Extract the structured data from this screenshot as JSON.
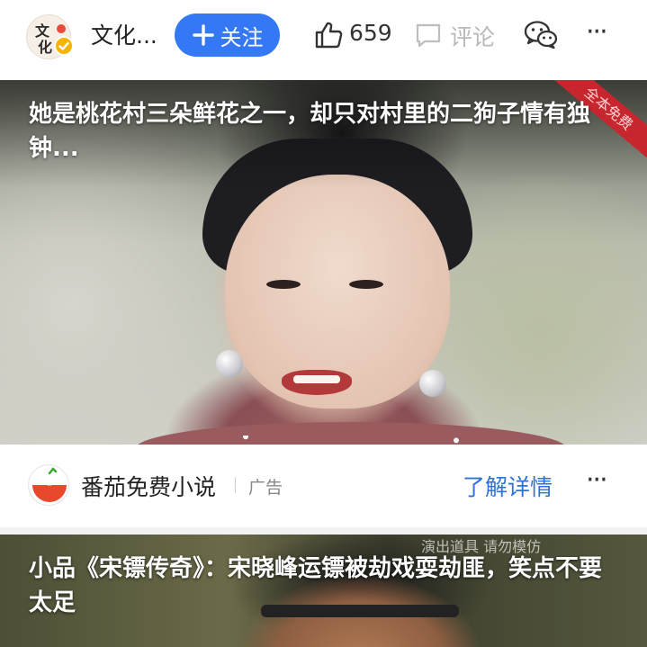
{
  "header": {
    "avatar_text_line1": "文",
    "avatar_text_line2": "化",
    "account_name": "文化...",
    "follow_label": "关注",
    "like_count": "659",
    "comment_label": "评论",
    "icons": [
      "verified-badge-icon",
      "plus-icon",
      "thumbs-up-icon",
      "comment-icon",
      "wechat-icon",
      "more-icon"
    ]
  },
  "video1": {
    "title": "她是桃花村三朵鲜花之一，却只对村里的二狗子情有独钟...",
    "ribbon": "全本免费"
  },
  "ad": {
    "name": "番茄免费小说",
    "tag": "广告",
    "cta": "了解详情",
    "more": "···"
  },
  "video2": {
    "title": "小品《宋镖传奇》：宋晓峰运镖被劫戏耍劫匪，笑点不要太足",
    "watermark": "演出道具 请勿模仿"
  },
  "colors": {
    "accent": "#3478f6",
    "cta": "#2f72d8",
    "muted": "#b9b9b9"
  }
}
